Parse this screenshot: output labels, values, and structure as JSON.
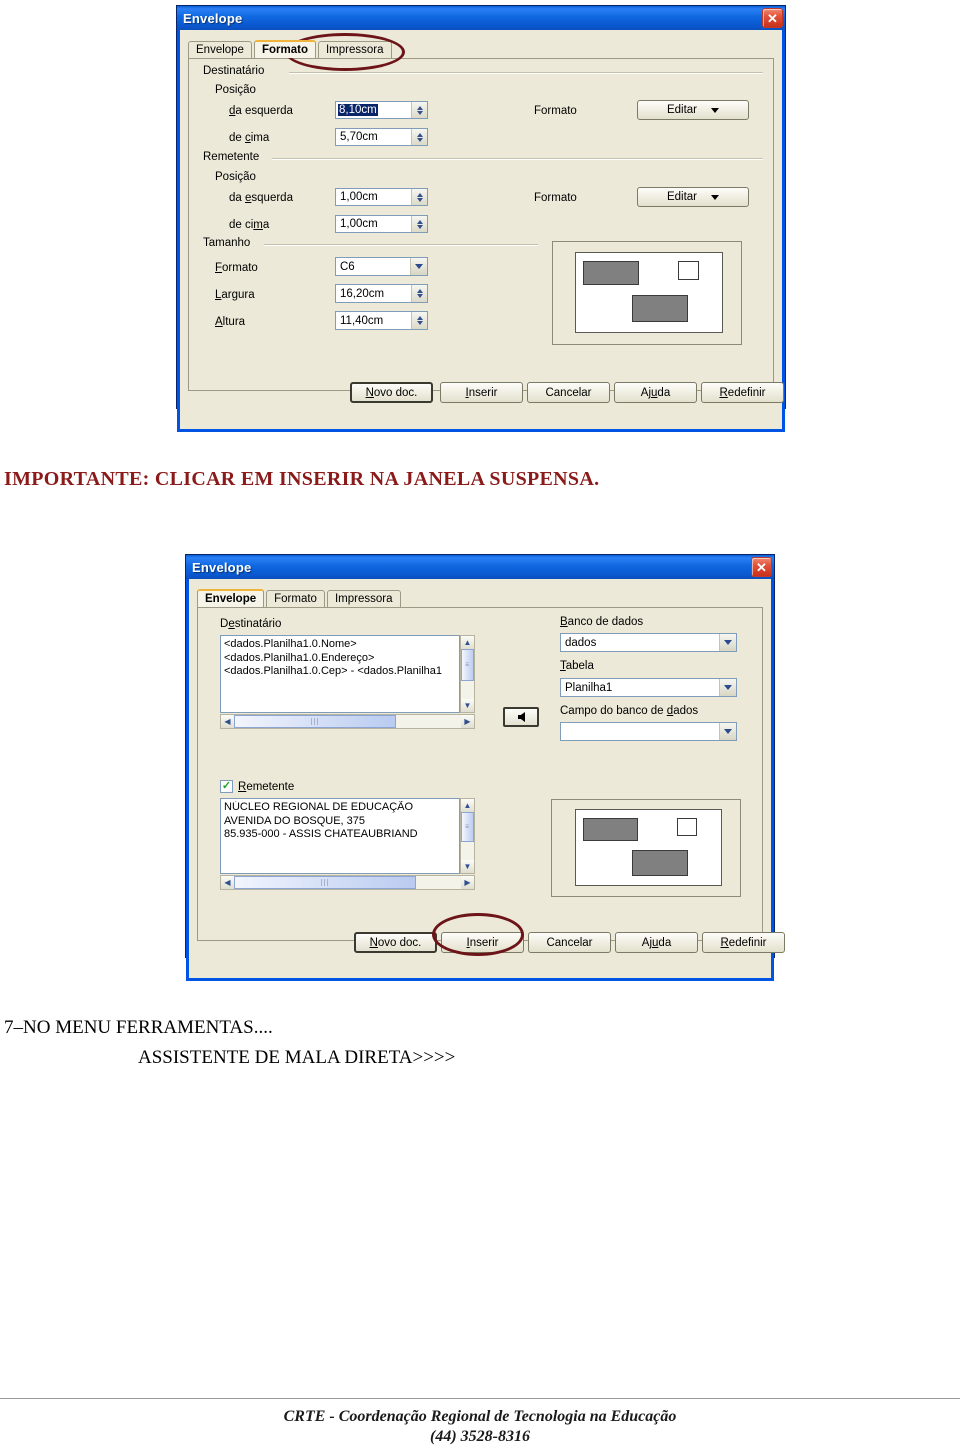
{
  "document": {
    "note_important": "IMPORTANTE: CLICAR EM INSERIR NA JANELA SUSPENSA.",
    "step_line1": "7–NO MENU FERRAMENTAS....",
    "step_line2": "ASSISTENTE DE MALA DIRETA>>>>",
    "footer_line1": "CRTE - Coordenação Regional de Tecnologia na Educação",
    "footer_line2": "(44) 3528-8316",
    "colors": {
      "note_red": "#8b1a1a",
      "annotation_red": "#6d1418",
      "titlebar_blue": "#0a56cd",
      "dialog_face": "#ece9d8"
    }
  },
  "dialog_format": {
    "title": "Envelope",
    "close_glyph": "✕",
    "tabs": [
      {
        "label": "Envelope",
        "active": false
      },
      {
        "label": "Formato",
        "active": true
      },
      {
        "label": "Impressora",
        "active": false
      }
    ],
    "groups": {
      "destinatario": "Destinatário",
      "remetente": "Remetente",
      "tamanho": "Tamanho"
    },
    "subgroups": {
      "posicao_1": "Posição",
      "posicao_2": "Posição"
    },
    "fields": {
      "dest_left_label": "da esquerda",
      "dest_left_value": "8,10cm",
      "dest_top_label": "de cima",
      "dest_top_value": "5,70cm",
      "rem_left_label": "da esquerda",
      "rem_left_value": "1,00cm",
      "rem_top_label": "de cima",
      "rem_top_value": "1,00cm",
      "size_format_label": "Formato",
      "size_format_value": "C6",
      "width_label": "Largura",
      "width_value": "16,20cm",
      "height_label": "Altura",
      "height_value": "11,40cm",
      "dest_format_label": "Formato",
      "dest_format_button": "Editar",
      "rem_format_label": "Formato",
      "rem_format_button": "Editar"
    },
    "buttons": [
      {
        "label": "Novo doc.",
        "default": true
      },
      {
        "label": "Inserir",
        "default": false
      },
      {
        "label": "Cancelar",
        "default": false
      },
      {
        "label": "Ajuda",
        "default": false
      },
      {
        "label": "Redefinir",
        "default": false
      }
    ]
  },
  "dialog_envelope": {
    "title": "Envelope",
    "close_glyph": "✕",
    "tabs": [
      {
        "label": "Envelope",
        "active": true
      },
      {
        "label": "Formato",
        "active": false
      },
      {
        "label": "Impressora",
        "active": false
      }
    ],
    "labels": {
      "destinatario": "Destinatário",
      "banco_de_dados": "Banco de dados",
      "tabela": "Tabela",
      "campo": "Campo do banco de dados",
      "remetente": "Remetente"
    },
    "recipient_lines": [
      "<dados.Planilha1.0.Nome>",
      "<dados.Planilha1.0.Endereço>",
      "<dados.Planilha1.0.Cep> - <dados.Planilha1"
    ],
    "sender_lines": [
      "NÚCLEO REGIONAL DE EDUCAÇÃO",
      "AVENIDA DO BOSQUE, 375",
      "85.935-000 - ASSIS CHATEAUBRIAND"
    ],
    "sender_checked": true,
    "selects": {
      "database_value": "dados",
      "table_value": "Planilha1",
      "field_value": ""
    },
    "insert_field_button": "insert-field-arrow",
    "buttons": [
      {
        "label": "Novo doc.",
        "default": true
      },
      {
        "label": "Inserir",
        "default": false
      },
      {
        "label": "Cancelar",
        "default": false
      },
      {
        "label": "Ajuda",
        "default": false
      },
      {
        "label": "Redefinir",
        "default": false
      }
    ]
  }
}
